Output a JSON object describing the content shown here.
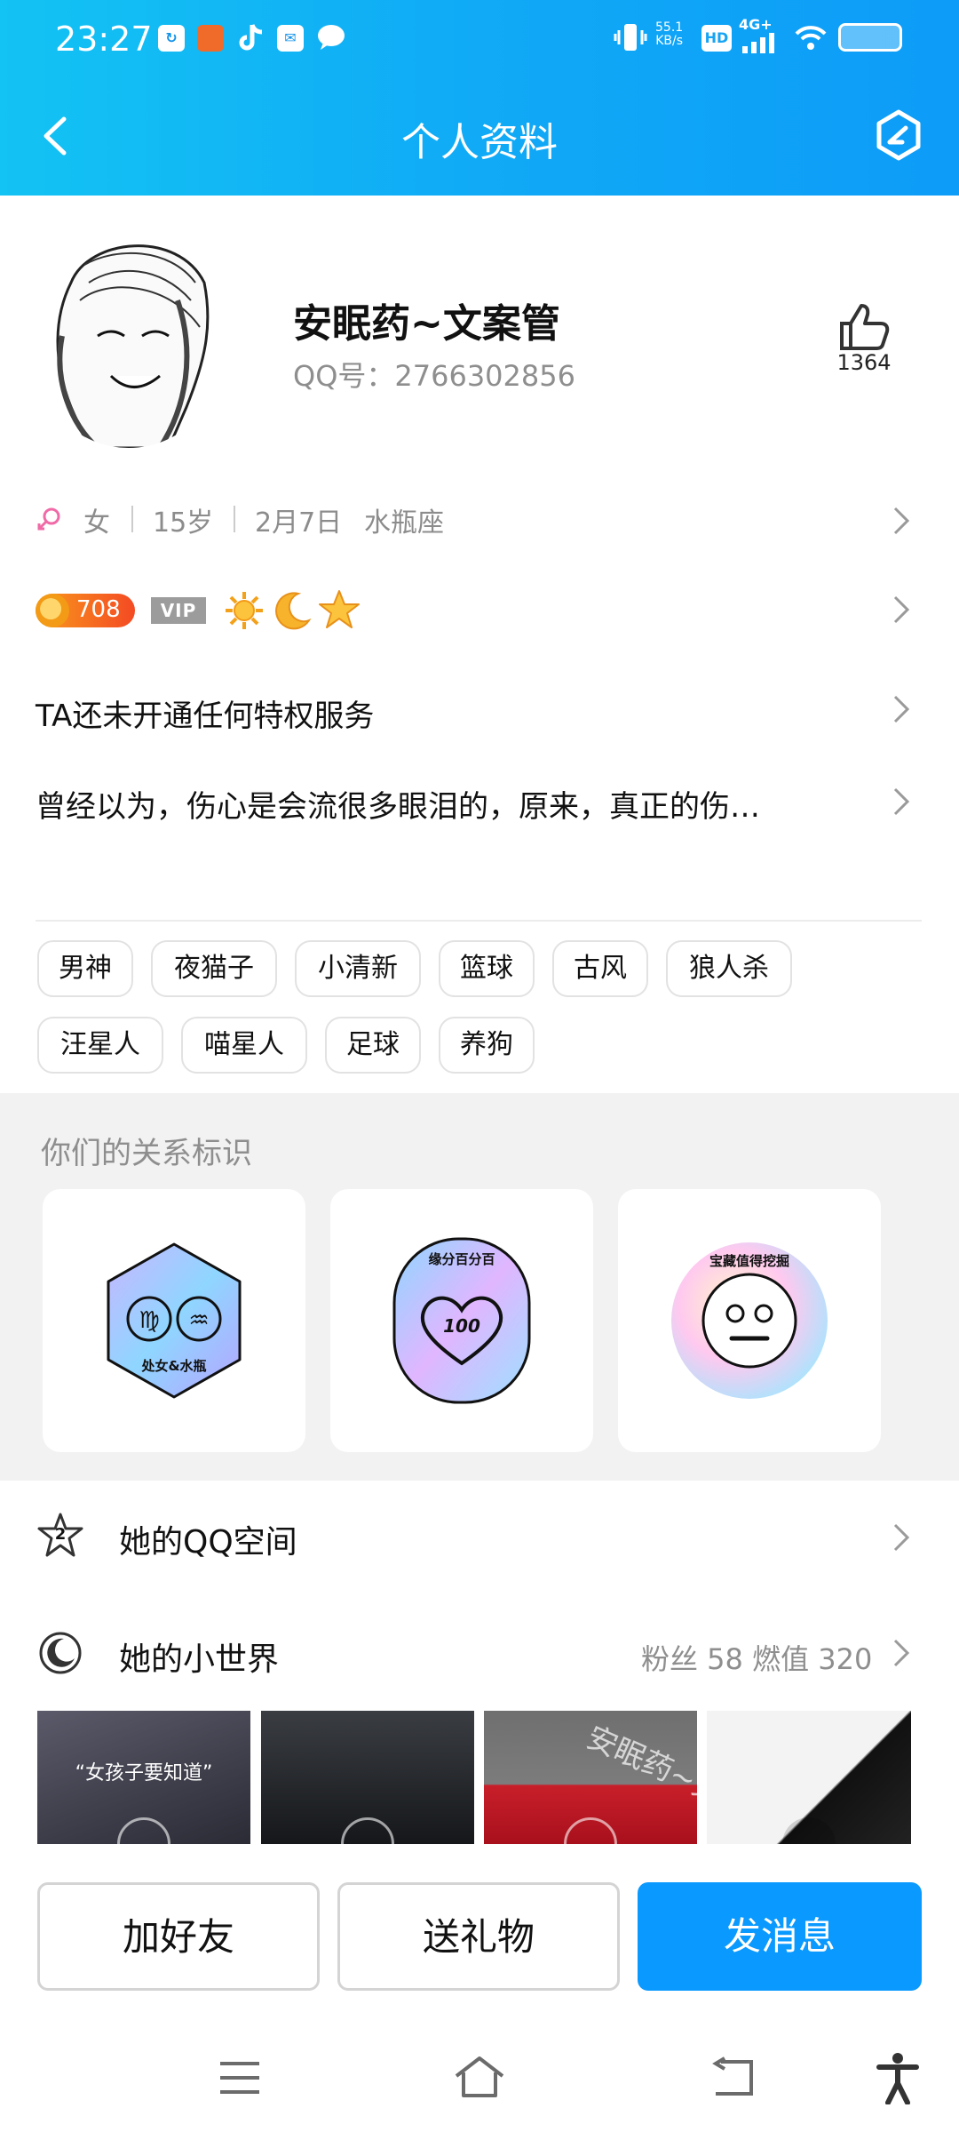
{
  "status_bar": {
    "time": "23:27",
    "net_speed_value": "55.1",
    "net_speed_unit": "KB/s",
    "hd": "HD",
    "network": "4G+",
    "notif_icons": [
      "sync-icon",
      "app-icon",
      "tiktok-icon",
      "mail-icon",
      "chat-icon"
    ]
  },
  "header": {
    "title": "个人资料"
  },
  "profile": {
    "nickname": "安眠药~文案管",
    "qq": "QQ号：2766302856",
    "likes": "1364"
  },
  "info": {
    "gender": "女",
    "age": "15岁",
    "birthday": "2月7日",
    "zodiac": "水瓶座"
  },
  "level": {
    "value": "708",
    "vip": "VIP",
    "badges": [
      "sun-icon",
      "moon-icon",
      "star-icon"
    ]
  },
  "privilege_text": "TA还未开通任何特权服务",
  "signature": "曾经以为，伤心是会流很多眼泪的，原来，真正的伤…",
  "tags": [
    "男神",
    "夜猫子",
    "小清新",
    "篮球",
    "古风",
    "狼人杀",
    "汪星人",
    "喵星人",
    "足球",
    "养狗"
  ],
  "relation": {
    "title": "你们的关系标识",
    "cards": [
      {
        "label": "处女&水瓶"
      },
      {
        "label": "缘分百分百",
        "value": "100"
      },
      {
        "label": "宝藏值得挖掘"
      }
    ]
  },
  "qzone": {
    "label": "她的QQ空间",
    "level": "2"
  },
  "world": {
    "label": "她的小世界",
    "stats": "粉丝 58  燃值 320",
    "thumb_captions": [
      "“女孩子要知道”",
      "",
      "安眠药~文",
      ""
    ]
  },
  "actions": {
    "add_friend": "加好友",
    "send_gift": "送礼物",
    "send_message": "发消息"
  },
  "colors": {
    "header": "#10aaf6",
    "primary": "#0a99ff"
  }
}
